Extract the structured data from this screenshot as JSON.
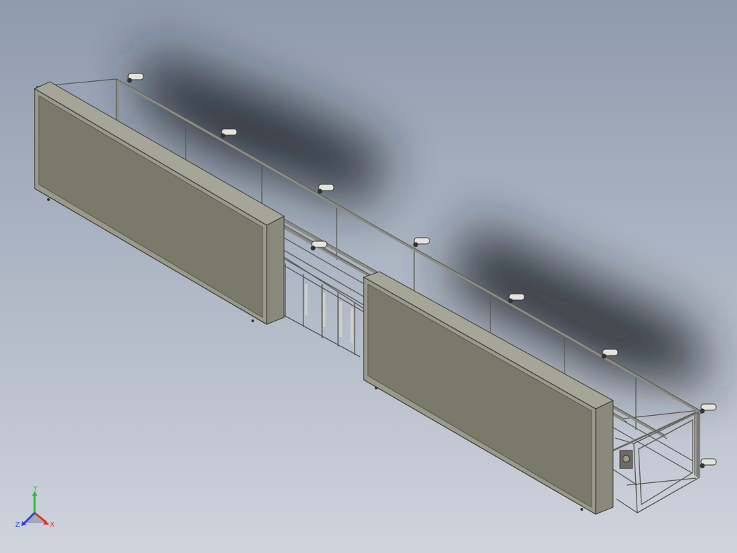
{
  "viewport": {
    "background_top": "#8e9bae",
    "background_bottom": "#cfd3dc"
  },
  "model": {
    "frame_color": "#8c8c82",
    "frame_dark": "#55554e",
    "panel_face": "#7a7a6a",
    "panel_edge": "#9a9a8c",
    "sensor_color": "#e4e4da"
  },
  "triad": {
    "y_label": "Y",
    "x_label": "X",
    "z_label": "Z",
    "y_color": "#2bbf3a",
    "x_color": "#e03030",
    "z_color": "#3040e0"
  }
}
